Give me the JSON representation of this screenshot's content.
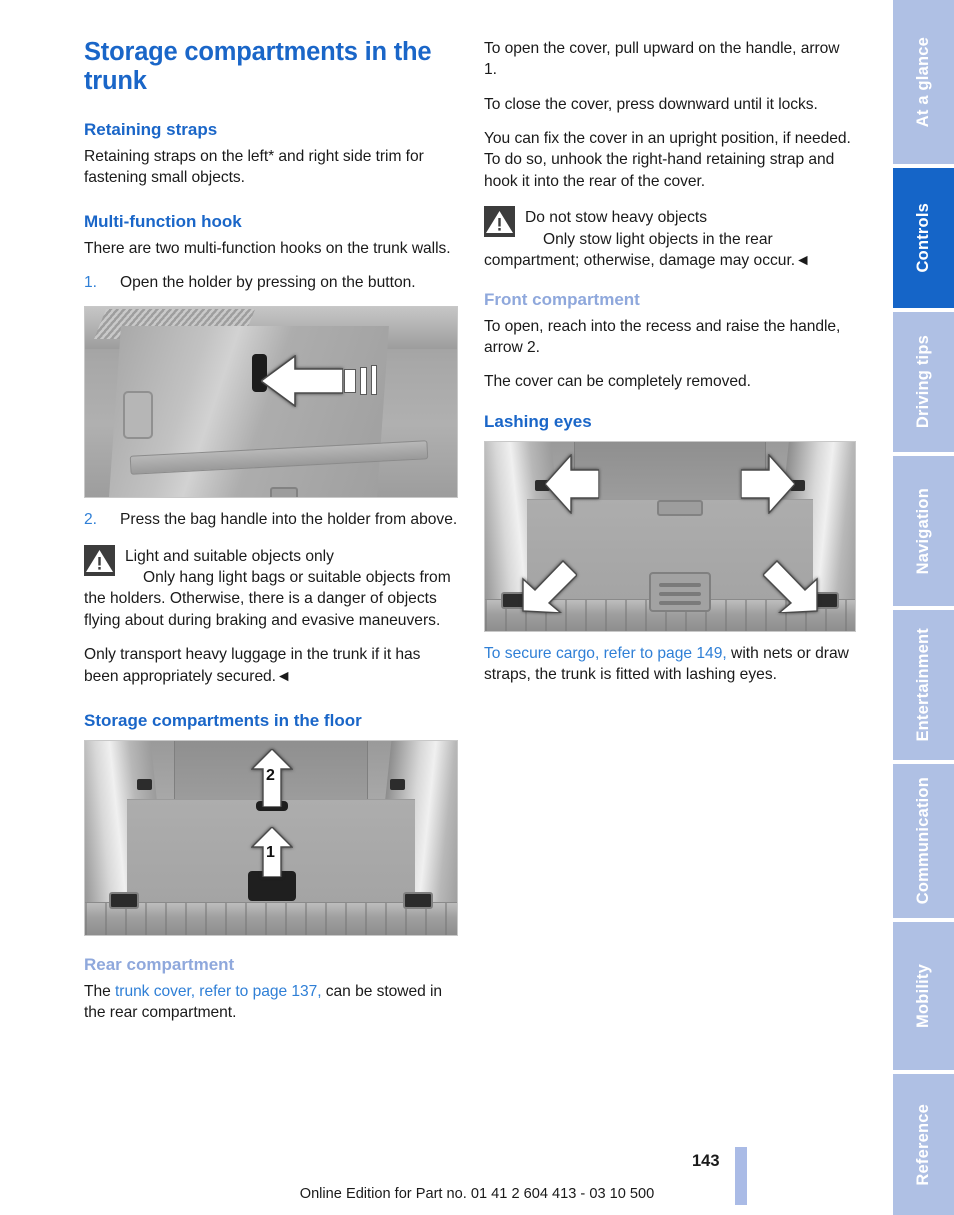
{
  "document": {
    "page_number": "143",
    "footer": "Online Edition for Part no. 01 41 2 604 413 - 03 10 500"
  },
  "colors": {
    "heading_primary": "#1a66c8",
    "heading_secondary": "#8fa8dc",
    "link": "#2f7fd6",
    "tab_active": "#1565c8",
    "tab_inactive": "#afc0e4",
    "page_marker": "#aabbe6"
  },
  "sidebar": {
    "tabs": [
      {
        "label": "At a glance",
        "active": false
      },
      {
        "label": "Controls",
        "active": true
      },
      {
        "label": "Driving tips",
        "active": false
      },
      {
        "label": "Navigation",
        "active": false
      },
      {
        "label": "Entertainment",
        "active": false
      },
      {
        "label": "Communication",
        "active": false
      },
      {
        "label": "Mobility",
        "active": false
      },
      {
        "label": "Reference",
        "active": false
      }
    ]
  },
  "left_column": {
    "title": "Storage compartments in the trunk",
    "retaining_straps": {
      "heading": "Retaining straps",
      "paragraph": "Retaining straps on the left* and right side trim for fastening small objects."
    },
    "multi_function_hook": {
      "heading": "Multi-function hook",
      "intro": "There are two multi-function hooks on the trunk walls.",
      "step1_num": "1.",
      "step1_text": "Open the holder by pressing on the button.",
      "figure_caption": "trunk side trim with multi-function hook button, arrow pointing at button",
      "step2_num": "2.",
      "step2_text": "Press the bag handle into the holder from above.",
      "warning_title": "Light and suitable objects only",
      "warning_body": "Only hang light bags or suitable objects from the holders. Otherwise, there is a danger of objects flying about during braking and evasive maneuvers.",
      "closing": "Only transport heavy luggage in the trunk if it has been appropriately secured.◄"
    },
    "floor_compartments": {
      "heading": "Storage compartments in the floor",
      "figure_caption": "trunk floor with two handles, arrows 1 and 2",
      "arrow_labels": [
        "1",
        "2"
      ]
    },
    "rear_compartment": {
      "heading": "Rear compartment",
      "text_before": "The ",
      "link": "trunk cover, refer to page 137,",
      "text_after": " can be stowed in the rear compartment."
    }
  },
  "right_column": {
    "paragraphs": [
      "To open the cover, pull upward on the handle, arrow 1.",
      "To close the cover, press downward until it locks.",
      "You can fix the cover in an upright position, if needed. To do so, unhook the right-hand retaining strap and hook it into the rear of the cover."
    ],
    "warning": {
      "title": "Do not stow heavy objects",
      "body": "Only stow light objects in the rear compartment; otherwise, damage may occur.◄"
    },
    "front_compartment": {
      "heading": "Front compartment",
      "paragraphs": [
        "To open, reach into the recess and raise the handle, arrow 2.",
        "The cover can be completely removed."
      ]
    },
    "lashing_eyes": {
      "heading": "Lashing eyes",
      "figure_caption": "trunk floor with four lashing eyes, arrows pointing at each",
      "caption_link": "To secure cargo, refer to page 149,",
      "caption_rest": " with nets or draw straps, the trunk is fitted with lashing eyes."
    }
  },
  "icons": {
    "warning": "warning-triangle-icon"
  }
}
